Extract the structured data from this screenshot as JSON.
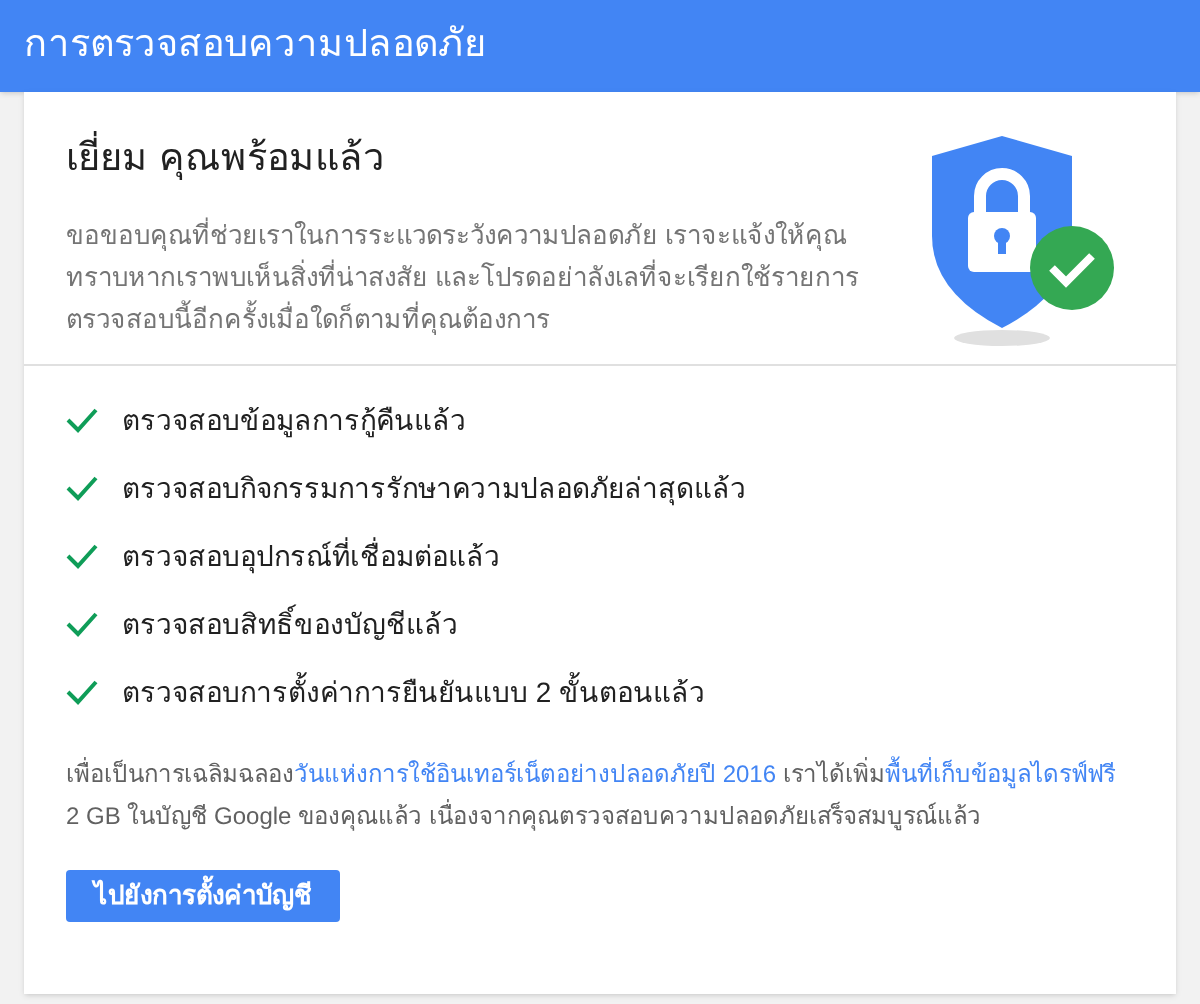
{
  "header": {
    "title": "การตรวจสอบความปลอดภัย"
  },
  "summary": {
    "heading": "เยี่ยม คุณพร้อมแล้ว",
    "text": "ขอขอบคุณที่ช่วยเราในการระแวดระวังความปลอดภัย เราจะแจ้งให้คุณทราบหากเราพบเห็นสิ่งที่น่าสงสัย และโปรดอย่าลังเลที่จะเรียกใช้รายการตรวจสอบนี้อีกครั้งเมื่อใดก็ตามที่คุณต้องการ"
  },
  "checklist": [
    {
      "label": "ตรวจสอบข้อมูลการกู้คืนแล้ว",
      "checked": true
    },
    {
      "label": "ตรวจสอบกิจกรรมการรักษาความปลอดภัยล่าสุดแล้ว",
      "checked": true
    },
    {
      "label": "ตรวจสอบอุปกรณ์ที่เชื่อมต่อแล้ว",
      "checked": true
    },
    {
      "label": "ตรวจสอบสิทธิ์ของบัญชีแล้ว",
      "checked": true
    },
    {
      "label": "ตรวจสอบการตั้งค่าการยืนยันแบบ 2 ขั้นตอนแล้ว",
      "checked": true
    }
  ],
  "note": [
    {
      "kind": "text",
      "text": "เพื่อเป็นการเฉลิมฉลอง"
    },
    {
      "kind": "link",
      "text": "วันแห่งการใช้อินเทอร์เน็ตอย่างปลอดภัยปี 2016"
    },
    {
      "kind": "text",
      "text": " เราได้เพิ่ม"
    },
    {
      "kind": "link",
      "text": "พื้นที่เก็บข้อมูลไดรฟ์ฟรี"
    },
    {
      "kind": "text",
      "text": " 2 GB ในบัญชี Google ของคุณแล้ว เนื่องจากคุณตรวจสอบความปลอดภัยเสร็จสมบูรณ์แล้ว"
    }
  ],
  "button": {
    "label": "ไปยังการตั้งค่าบัญชี"
  }
}
